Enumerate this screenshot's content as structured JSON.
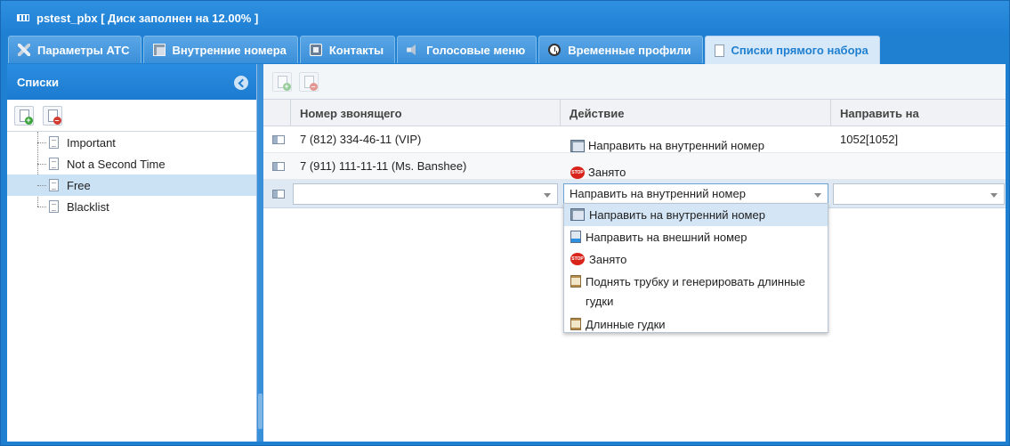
{
  "window": {
    "title": "pstest_pbx [ Диск заполнен на 12.00% ]"
  },
  "tabs": [
    {
      "label": "Параметры АТС",
      "icon": "tools-icon",
      "active": false
    },
    {
      "label": "Внутренние номера",
      "icon": "phones-icon",
      "active": false
    },
    {
      "label": "Контакты",
      "icon": "contacts-icon",
      "active": false
    },
    {
      "label": "Голосовые меню",
      "icon": "speaker-icon",
      "active": false
    },
    {
      "label": "Временные профили",
      "icon": "clock-icon",
      "active": false
    },
    {
      "label": "Списки прямого набора",
      "icon": "document-icon",
      "active": true
    }
  ],
  "sidebar": {
    "title": "Списки",
    "toolbar": {
      "add": "add-list-icon",
      "remove": "remove-list-icon"
    },
    "items": [
      {
        "label": "Important",
        "selected": false
      },
      {
        "label": "Not a Second Time",
        "selected": false
      },
      {
        "label": "Free",
        "selected": true
      },
      {
        "label": "Blacklist",
        "selected": false
      }
    ]
  },
  "grid": {
    "columns": [
      "Номер звонящего",
      "Действие",
      "Направить на"
    ],
    "rows": [
      {
        "caller": "7 (812) 334-46-11 (VIP)",
        "action": "Направить на внутренний номер",
        "action_icon": "phone-forward-icon",
        "target": "1052[1052]"
      },
      {
        "caller": "7 (911) 111-11-11 (Ms. Banshee)",
        "action": "Занято",
        "action_icon": "stop-icon",
        "target": ""
      }
    ],
    "editor": {
      "caller_value": "",
      "action_value": "Направить на внутренний номер",
      "target_value": ""
    }
  },
  "dropdown": {
    "options": [
      {
        "label": "Направить на внутренний номер",
        "icon": "phone-forward-icon",
        "selected": true
      },
      {
        "label": "Направить на внешний номер",
        "icon": "external-phone-icon",
        "selected": false
      },
      {
        "label": "Занято",
        "icon": "stop-icon",
        "selected": false
      },
      {
        "label": "Поднять трубку и генерировать длинные гудки",
        "icon": "long-tones-icon",
        "selected": false
      },
      {
        "label": "Длинные гудки",
        "icon": "long-tones-icon",
        "selected": false
      }
    ]
  },
  "colors": {
    "accent": "#1f7fd0",
    "tab_active_bg": "#d7e9f8",
    "selection": "#cbe2f5"
  }
}
